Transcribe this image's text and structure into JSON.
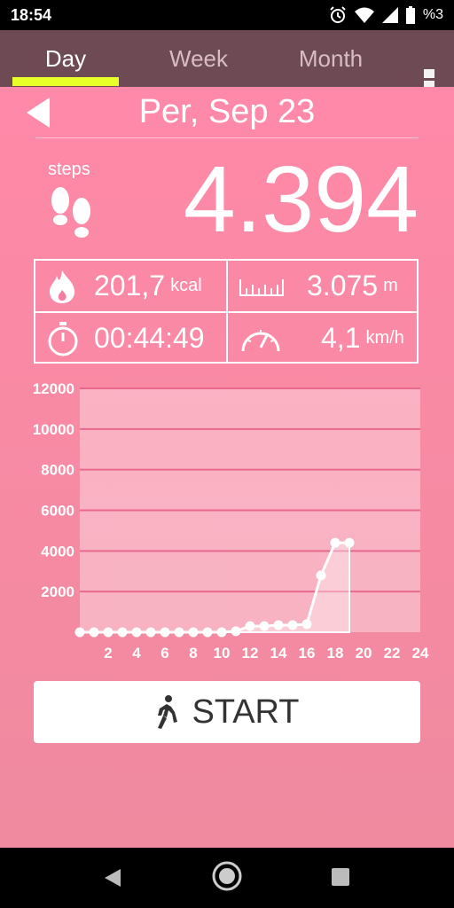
{
  "status_bar": {
    "time": "18:54",
    "battery": "%3"
  },
  "tabs": [
    {
      "label": "Day"
    },
    {
      "label": "Week"
    },
    {
      "label": "Month"
    }
  ],
  "date": "Per, Sep 23",
  "steps": {
    "label": "steps",
    "value": "4.394"
  },
  "stats": {
    "calories": {
      "value": "201,7",
      "unit": "kcal"
    },
    "distance": {
      "value": "3.075",
      "unit": "m"
    },
    "duration": {
      "value": "00:44:49"
    },
    "speed": {
      "value": "4,1",
      "unit": "km/h"
    }
  },
  "start_label": "START",
  "chart_data": {
    "type": "area",
    "x": [
      0,
      1,
      2,
      3,
      4,
      5,
      6,
      7,
      8,
      9,
      10,
      11,
      12,
      13,
      14,
      15,
      16,
      17,
      18,
      19
    ],
    "values": [
      0,
      0,
      0,
      0,
      0,
      0,
      0,
      0,
      0,
      0,
      0,
      50,
      300,
      300,
      350,
      350,
      400,
      2800,
      4400,
      4400
    ],
    "xticks": [
      "2",
      "4",
      "6",
      "8",
      "10",
      "12",
      "14",
      "16",
      "18",
      "20",
      "22",
      "24"
    ],
    "yticks": [
      "2000",
      "4000",
      "6000",
      "8000",
      "10000",
      "12000"
    ],
    "xlim": [
      0,
      24
    ],
    "ylim": [
      0,
      12000
    ],
    "grid": true,
    "colors": {
      "fill": "#ffffff",
      "line": "#ffffff",
      "grid": "#e8688e"
    }
  }
}
